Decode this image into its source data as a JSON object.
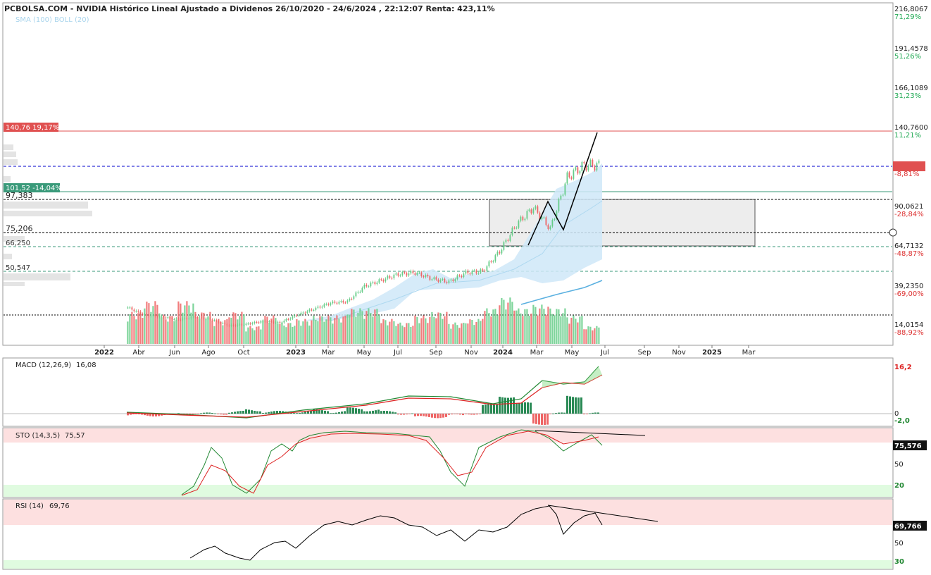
{
  "header": {
    "title": "PCBOLSA.COM - NVIDIA Histórico Lineal Ajustado a Dividenos 26/10/2020 - 24/6/2024 , 22:12:07 Renta: 423,11%",
    "indicators_legend": "SMA (100) BOLL (20)"
  },
  "colors": {
    "up": "#66cc88",
    "down": "#ee6666",
    "boll_fill": "#cfe8f8",
    "sma": "#5ab0e0",
    "support_dashed": "#3a9a7a",
    "current_price": "#0000cc",
    "resistance": "#e05050",
    "macd_line": "#228833",
    "signal_line": "#dd2222",
    "overbought_zone": "#fde0e0",
    "oversold_zone": "#e0fbe0"
  },
  "price_axis": [
    {
      "price": "216,8067",
      "pct": "71,29%"
    },
    {
      "price": "191,4578",
      "pct": "51,26%"
    },
    {
      "price": "166,1089",
      "pct": "31,23%"
    },
    {
      "price": "140,7600",
      "pct": "11,21%"
    },
    {
      "price": "118,1100",
      "pct": "-8,81%"
    },
    {
      "price": "90,0621",
      "pct": "-28,84%"
    },
    {
      "price": "64,7132",
      "pct": "-48,87%"
    },
    {
      "price": "39,2350",
      "pct": "-69,00%"
    },
    {
      "price": "14,0154",
      "pct": "-88,92%"
    }
  ],
  "left_labels": {
    "resistance": "140,76  19,17%",
    "support_green": "101,52  -14,04%",
    "level_973": "97,383",
    "level_752": "75,206",
    "level_662": "66,250",
    "level_505": "50,547"
  },
  "time_axis": [
    "2022",
    "Abr",
    "Jun",
    "Ago",
    "Oct",
    "2023",
    "Mar",
    "May",
    "Jul",
    "Sep",
    "Nov",
    "2024",
    "Mar",
    "May",
    "Jul",
    "Sep",
    "Nov",
    "2025",
    "Mar"
  ],
  "macd": {
    "label": "MACD (12,26,9)",
    "value": "16,08",
    "axis": [
      "16,2",
      "0",
      "-2,0"
    ]
  },
  "sto": {
    "label": "STO (14,3,5)",
    "value": "75,57",
    "axis": [
      "75,576",
      "50",
      "20"
    ]
  },
  "rsi": {
    "label": "RSI (14)",
    "value": "69,76",
    "axis": [
      "69,766",
      "50",
      "30"
    ]
  },
  "chart_data": {
    "type": "candlestick",
    "title": "PCBOLSA.COM - NVIDIA Histórico Lineal Ajustado a Dividenos 26/10/2020 - 24/6/2024 , 22:12:07 Renta: 423,11%",
    "x": [
      "2022-03",
      "2022-04",
      "2022-05",
      "2022-06",
      "2022-07",
      "2022-08",
      "2022-09",
      "2022-10",
      "2022-11",
      "2022-12",
      "2023-01",
      "2023-02",
      "2023-03",
      "2023-04",
      "2023-05",
      "2023-06",
      "2023-07",
      "2023-08",
      "2023-09",
      "2023-10",
      "2023-11",
      "2023-12",
      "2024-01",
      "2024-02",
      "2024-03",
      "2024-04",
      "2024-05",
      "2024-06"
    ],
    "close": [
      24,
      19,
      18,
      16,
      18,
      16,
      12,
      13,
      15,
      14,
      19,
      23,
      27,
      28,
      38,
      42,
      46,
      47,
      43,
      41,
      47,
      48,
      61,
      79,
      90,
      76,
      110,
      118
    ],
    "volume": [
      9,
      12,
      8,
      12,
      9,
      7,
      9,
      5,
      8,
      6,
      7,
      8,
      8,
      10,
      10,
      7,
      6,
      8,
      9,
      6,
      7,
      10,
      13,
      10,
      11,
      10,
      8,
      5
    ],
    "ylim": [
      0,
      216.8067
    ],
    "levels": [
      140.76,
      118.11,
      101.52,
      97.383,
      75.206,
      66.25,
      50.547
    ],
    "macd": [
      0,
      -0.5,
      -1,
      -1.5,
      -1.5,
      -1.5,
      -1.5,
      -1,
      0,
      0.5,
      1,
      1.5,
      2.5,
      3,
      4.5,
      5.5,
      6,
      6,
      5,
      4,
      3.5,
      3.5,
      6,
      11,
      14,
      11,
      11,
      16.08
    ],
    "sto": [
      22,
      70,
      50,
      25,
      75,
      55,
      90,
      95,
      95,
      90,
      88,
      90,
      80,
      55,
      30,
      80,
      90,
      95,
      85,
      95,
      90,
      85,
      90,
      80,
      55,
      80,
      85,
      75.57
    ],
    "rsi": [
      42,
      48,
      50,
      45,
      56,
      52,
      62,
      60,
      64,
      62,
      60,
      58,
      64,
      66,
      68,
      58,
      55,
      60,
      64,
      68,
      72,
      76,
      58,
      66,
      70,
      69.76
    ]
  }
}
